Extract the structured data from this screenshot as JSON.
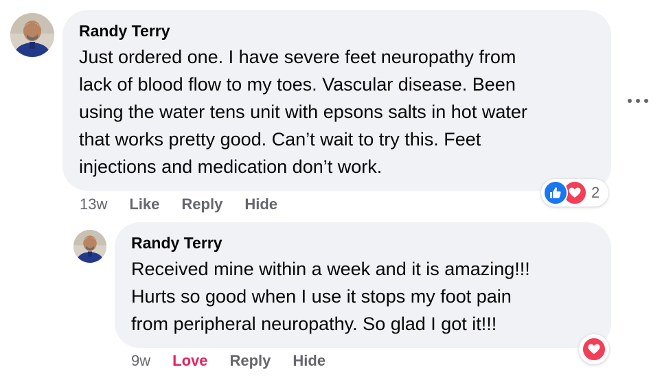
{
  "comments": [
    {
      "author": "Randy Terry",
      "lines": [
        "Just ordered one. I have severe feet neuropathy from",
        "lack of blood flow to my toes. Vascular disease. Been",
        "using the water tens unit with epsons salts in hot water",
        "that works pretty good. Can’t wait to try this. Feet",
        "injections and medication don’t work."
      ],
      "time": "13w",
      "actions": {
        "like": "Like",
        "reply": "Reply",
        "hide": "Hide"
      },
      "reactions": {
        "icons": [
          "like-icon",
          "love-icon"
        ],
        "count": "2"
      }
    },
    {
      "author": "Randy Terry",
      "lines": [
        "Received mine within a week and it is amazing!!!",
        "Hurts so good when I use it stops my foot pain",
        "from peripheral neuropathy. So glad I got it!!!"
      ],
      "time": "9w",
      "actions": {
        "love": "Love",
        "reply": "Reply",
        "hide": "Hide"
      },
      "reactions": {
        "icons": [
          "love-icon"
        ]
      }
    }
  ],
  "colors": {
    "bubble": "#f0f2f5",
    "like_blue": "#1877f2",
    "love_red": "#f33e58",
    "love_text": "#e0245e",
    "meta_gray": "#65676b"
  }
}
